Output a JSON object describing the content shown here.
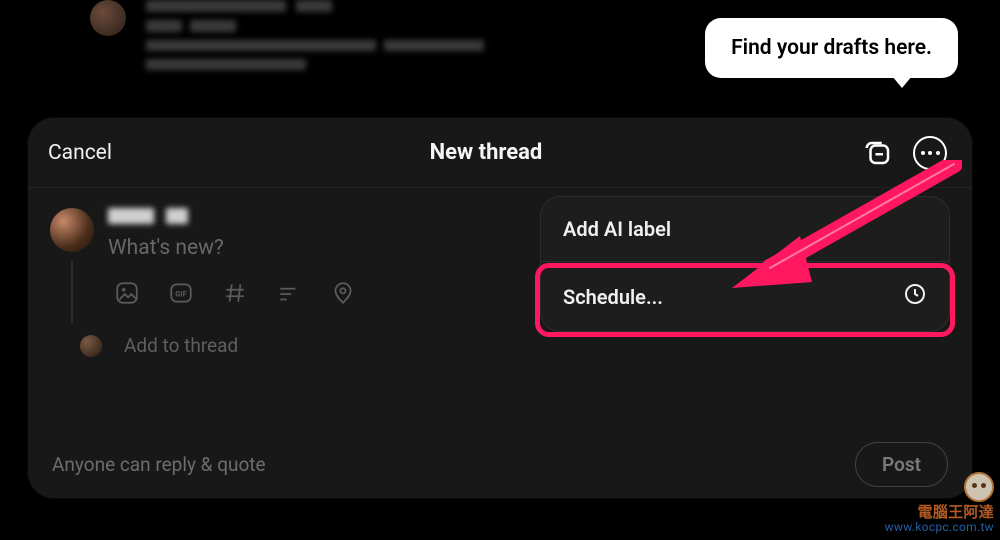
{
  "callout": {
    "text": "Find your drafts here."
  },
  "composer": {
    "cancel_label": "Cancel",
    "title": "New thread",
    "placeholder": "What's new?",
    "add_to_thread": "Add to thread",
    "reply_scope": "Anyone can reply & quote",
    "post_label": "Post"
  },
  "menu": {
    "items": [
      {
        "label": "Add AI label"
      },
      {
        "label": "Schedule..."
      }
    ]
  },
  "watermark": {
    "line1": "電腦王阿達",
    "line2": "www.kocpc.com.tw"
  }
}
